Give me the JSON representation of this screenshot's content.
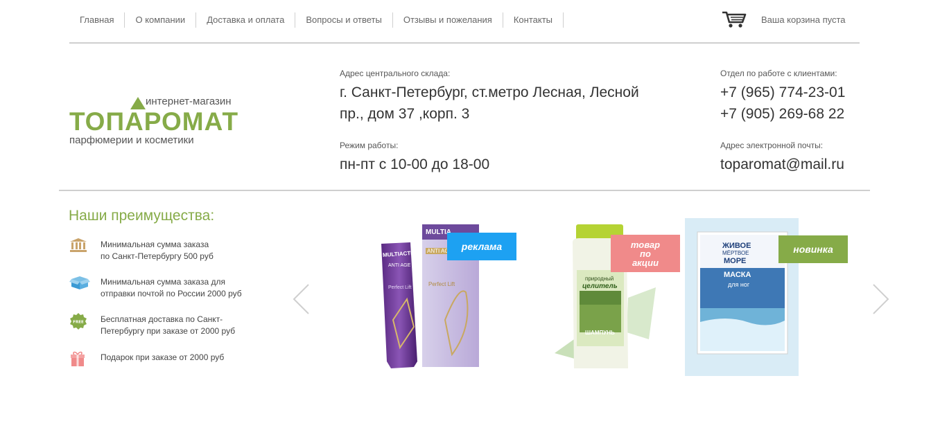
{
  "nav": {
    "items": [
      "Главная",
      "О компании",
      "Доставка и оплата",
      "Вопросы и ответы",
      "Отзывы и пожелания",
      "Контакты"
    ]
  },
  "cart": {
    "label": "Ваша корзина пуста",
    "icon": "cart-icon"
  },
  "logo": {
    "tagline_top": "интернет-магазин",
    "brand": "ТОПАРОМАТ",
    "tagline_bottom": "парфюмерии и косметики",
    "color": "#86ab48"
  },
  "contacts": {
    "address_label": "Адрес центрального склада:",
    "address_line1": "г. Санкт-Петербург, ст.метро Лесная, Лесной",
    "address_line2": "пр., дом 37 ,корп. 3",
    "hours_label": "Режим работы:",
    "hours": "пн-пт с 10-00 до 18-00",
    "phones_label": "Отдел по работе с клиентами:",
    "phone1": "+7 (965) 774-23-01",
    "phone2": "+7 (905) 269-68 22",
    "email_label": "Адрес электронной почты:",
    "email": "toparomat@mail.ru"
  },
  "advantages": {
    "title": "Наши преимущества:",
    "items": [
      {
        "icon": "bank-icon",
        "line1": "Минимальная сумма заказа",
        "line2": "по Санкт-Петербургу 500 руб"
      },
      {
        "icon": "box-icon",
        "line1": "Минимальная сумма заказа для",
        "line2": "отправки почтой по России 2000 руб"
      },
      {
        "icon": "free-badge-icon",
        "line1": "Бесплатная доставка по Санкт-",
        "line2": "Петербургу при заказе от 2000 руб"
      },
      {
        "icon": "gift-icon",
        "line1": "Подарок при заказе от 2000 руб",
        "line2": ""
      }
    ]
  },
  "slider": {
    "products": [
      {
        "badge": "реклама",
        "badge_color": "#1da1f2",
        "tube_brand": "MULTIACTIV M",
        "tube_sub": "ANTI AGE",
        "tube_text": "Perfect Lift",
        "box_brand": "MULTIA",
        "box_sub": "ANTI AG",
        "box_text": "Perfect Lift"
      },
      {
        "badge_line1": "товар",
        "badge_line2": "по",
        "badge_line3": "акции",
        "badge_color": "#f08a8a",
        "label_top": "природный",
        "label_brand": "целитель",
        "label_product": "ШАМПУНЬ"
      },
      {
        "badge": "новинка",
        "badge_color": "#86ab48",
        "line1": "ЖИВОЕ",
        "line2": "МЁРТВОЕ",
        "line3": "МОРЕ",
        "line4": "МАСКА",
        "line5": "для ног"
      }
    ]
  }
}
